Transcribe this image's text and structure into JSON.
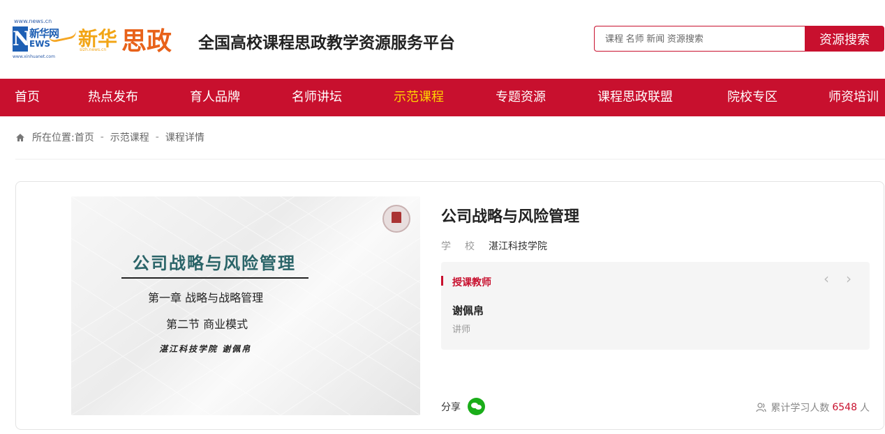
{
  "header": {
    "news_logo": {
      "url_top": "www.news.cn",
      "n_letter": "N",
      "xinhuawang": "新华网",
      "ews": "EWS",
      "url_bottom": "www.xinhuanet.com"
    },
    "brand_logo": {
      "xinhua": "新华",
      "sizheng": "思政",
      "small": "sizh.news.cn"
    },
    "site_title": "全国高校课程思政教学资源服务平台",
    "search": {
      "placeholder": "课程 名师 新闻 资源搜索",
      "button_label": "资源搜索"
    }
  },
  "nav": {
    "items": [
      {
        "label": "首页"
      },
      {
        "label": "热点发布"
      },
      {
        "label": "育人品牌"
      },
      {
        "label": "名师讲坛"
      },
      {
        "label": "示范课程"
      },
      {
        "label": "专题资源"
      },
      {
        "label": "课程思政联盟"
      },
      {
        "label": "院校专区"
      },
      {
        "label": "师资培训"
      }
    ],
    "active": "示范课程",
    "bg_color": "#c8102e",
    "active_color": "#ffd400"
  },
  "breadcrumb": {
    "icon": "home-icon",
    "prefix": "所在位置:",
    "items": [
      "首页",
      "示范课程",
      "课程详情"
    ],
    "separator": "-"
  },
  "course": {
    "cover": {
      "title": "公司战略与风险管理",
      "chapter": "第一章  战略与战略管理",
      "section": "第二节  商业模式",
      "author_line": "湛江科技学院   谢佩帛"
    },
    "title": "公司战略与风险管理",
    "school_label": "学校",
    "school_value": "湛江科技学院",
    "teacher_box": {
      "heading": "授课教师",
      "prev_icon": "chevron-left-icon",
      "next_icon": "chevron-right-icon",
      "name": "谢佩帛",
      "role": "讲师"
    },
    "share_label": "分享",
    "share_icon": "wechat-icon",
    "learners": {
      "icon": "user-icon",
      "label": "累计学习人数",
      "count": "6548",
      "unit": "人"
    }
  }
}
